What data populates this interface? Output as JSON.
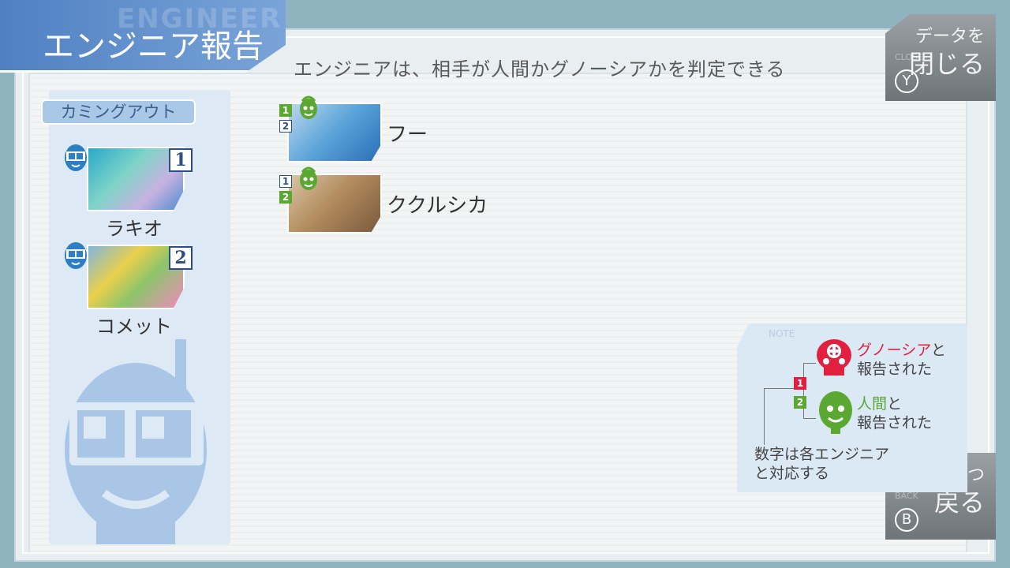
{
  "title": {
    "ghost": "ENGINEER",
    "main": "エンジニア報告"
  },
  "subtitle": "エンジニアは、相手が人間かグノーシアかを判定できる",
  "close_button": {
    "line1": "データを",
    "line2": "閉じる",
    "ghost": "CLOSE",
    "key": "Y"
  },
  "back_button": {
    "line1": "一つ",
    "line2": "戻る",
    "ghost": "BACK",
    "key": "B"
  },
  "coming_out": {
    "tab_label": "カミングアウト",
    "engineers": [
      {
        "name": "ラキオ",
        "number": "1",
        "head_color": "#2d7fc4"
      },
      {
        "name": "コメット",
        "number": "2",
        "head_color": "#2d7fc4"
      }
    ]
  },
  "reports": [
    {
      "name": "フー",
      "marks": [
        {
          "n": "1",
          "style": "filled"
        },
        {
          "n": "2",
          "style": "empty"
        }
      ],
      "result_color": "#5aa832"
    },
    {
      "name": "ククルシカ",
      "marks": [
        {
          "n": "1",
          "style": "empty"
        },
        {
          "n": "2",
          "style": "filled"
        }
      ],
      "result_color": "#5aa832"
    }
  ],
  "note": {
    "ghost": "NOTE",
    "gnosia_label": "グノーシア",
    "gnosia_suffix": "と",
    "gnosia_line2": "報告された",
    "human_label": "人間",
    "human_suffix": "と",
    "human_line2": "報告された",
    "mark1": "1",
    "mark2": "2",
    "footer_line1": "数字は各エンジニア",
    "footer_line2": "と対応する",
    "colors": {
      "gnosia": "#e0203e",
      "human": "#5aa832"
    }
  }
}
